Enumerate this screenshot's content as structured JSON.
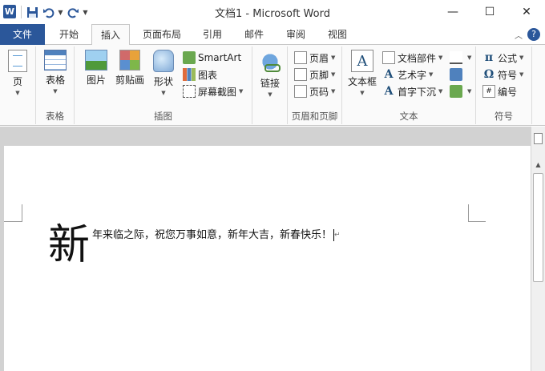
{
  "window": {
    "app_icon": "W",
    "title": "文档1 - Microsoft Word",
    "minimize_icon": "minimize-icon",
    "maximize_icon": "maximize-icon",
    "close_icon": "close-icon"
  },
  "qat": {
    "save_icon": "save-icon",
    "undo_icon": "undo-icon",
    "redo_icon": "redo-icon",
    "customize_icon": "qat-customize-icon"
  },
  "tabs": {
    "file": "文件",
    "home": "开始",
    "insert": "插入",
    "layout": "页面布局",
    "references": "引用",
    "mailings": "邮件",
    "review": "审阅",
    "view": "视图"
  },
  "ribbon": {
    "pages": {
      "button": "页",
      "label": ""
    },
    "tables": {
      "button": "表格",
      "label": "表格"
    },
    "illustrations": {
      "picture": "图片",
      "clipart": "剪贴画",
      "shapes": "形状",
      "smartart": "SmartArt",
      "chart": "图表",
      "screenshot": "屏幕截图",
      "label": "插图"
    },
    "links": {
      "button": "链接",
      "label": ""
    },
    "header_footer": {
      "header": "页眉",
      "footer": "页脚",
      "page_number": "页码",
      "label": "页眉和页脚"
    },
    "text": {
      "textbox": "文本框",
      "quickparts": "文档部件",
      "wordart": "艺术字",
      "dropcap": "首字下沉",
      "label": "文本"
    },
    "symbols": {
      "equation": "公式",
      "symbol": "符号",
      "numbering": "编号",
      "label": "符号"
    }
  },
  "document": {
    "dropcap_char": "新",
    "body_text": "年来临之际，祝您万事如意，新年大吉，新春快乐！",
    "para_mark": "↵"
  },
  "colors": {
    "accent": "#2b579a",
    "ribbon_bg": "#fafafa",
    "doc_bg": "#d2d2d2"
  }
}
